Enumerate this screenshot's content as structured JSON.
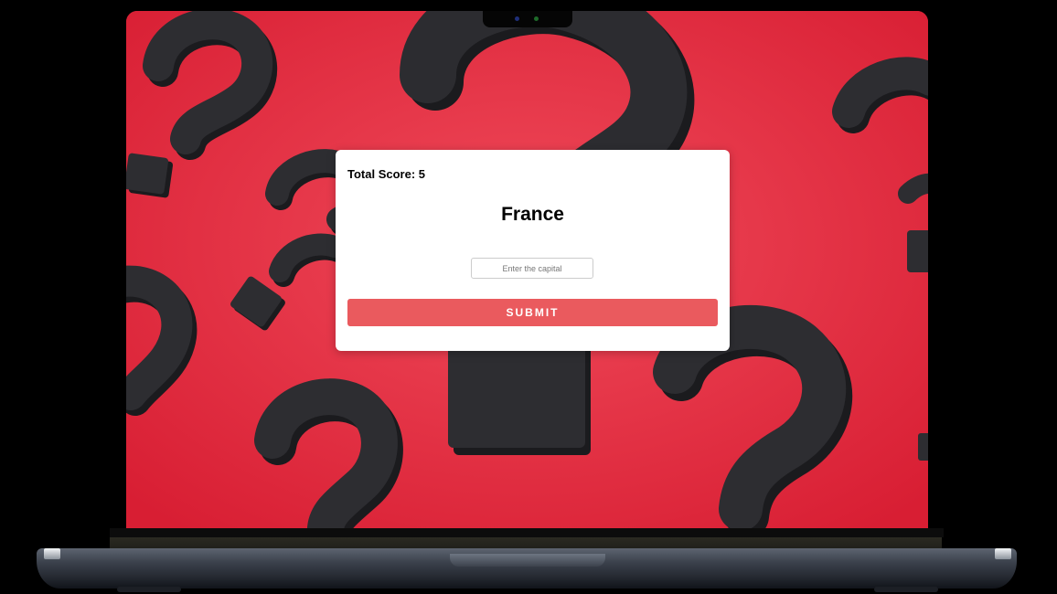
{
  "quiz": {
    "score_text": "Total Score: 5",
    "country": "France",
    "answer_input": {
      "value": "",
      "placeholder": "Enter the capital"
    },
    "submit_label": "SUBMIT"
  },
  "colors": {
    "background_red": "#e8354a",
    "question_mark": "#2a2a2e",
    "submit_button": "#ea5a5e",
    "card": "#ffffff"
  },
  "icons": {
    "wallpaper": "question-mark-pattern"
  }
}
